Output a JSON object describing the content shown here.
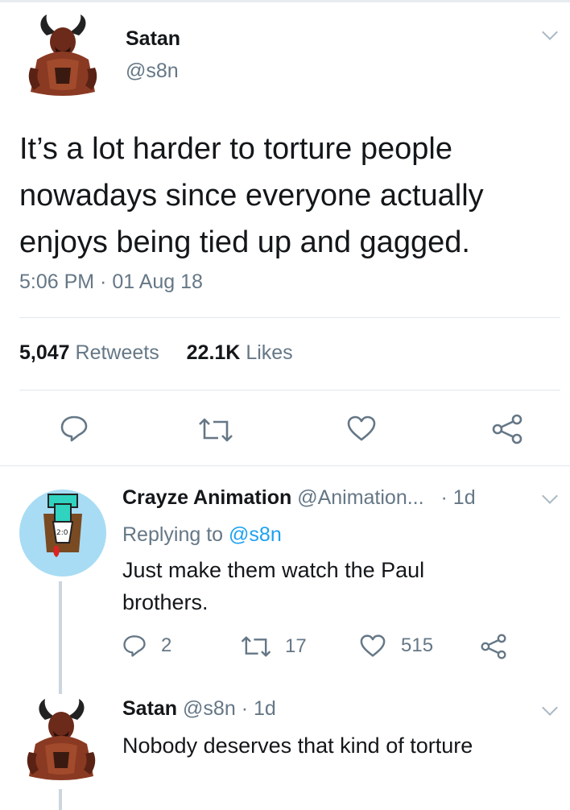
{
  "main_tweet": {
    "author_name": "Satan",
    "handle": "@s8n",
    "text": "It’s a lot harder to torture people nowadays since everyone actually enjoys being tied up and gagged.",
    "timestamp": "5:06 PM · 01 Aug 18",
    "retweets_count": "5,047",
    "retweets_label": "Retweets",
    "likes_count": "22.1K",
    "likes_label": "Likes"
  },
  "reply_1": {
    "author_name": "Crayze Animation",
    "handle": "@Animation...",
    "age": "· 1d",
    "replying_prefix": "Replying to",
    "replying_to": "@s8n",
    "text": "Just make them watch the Paul brothers.",
    "reply_count": "2",
    "retweet_count": "17",
    "like_count": "515"
  },
  "reply_2": {
    "author_name": "Satan",
    "handle": "@s8n",
    "age": "· 1d",
    "text": "Nobody deserves that kind of torture"
  },
  "icons": {
    "reply": "reply-icon",
    "retweet": "retweet-icon",
    "like": "heart-icon",
    "share": "share-icon",
    "more": "chevron-down-icon"
  },
  "colors": {
    "text": "#14171a",
    "muted": "#657786",
    "link": "#1da1f2",
    "icon": "#657786",
    "divider": "#e1e8ed"
  }
}
